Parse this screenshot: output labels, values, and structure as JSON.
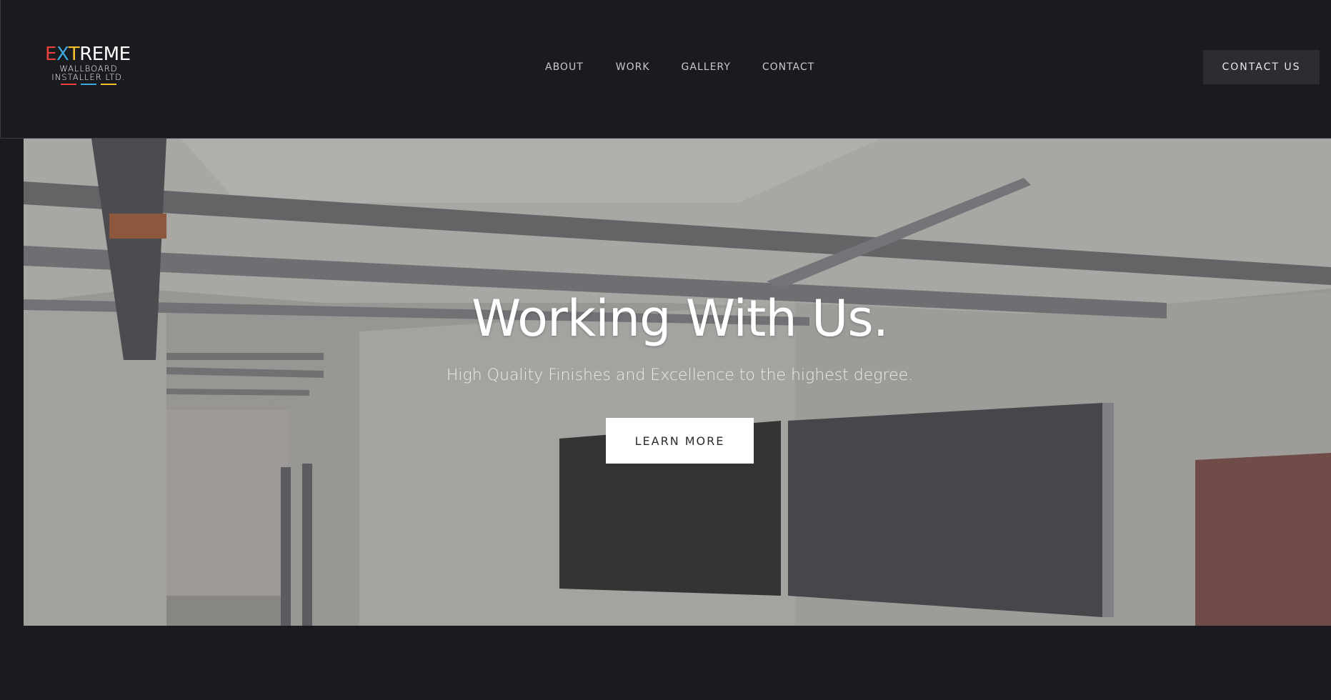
{
  "header": {
    "logo": {
      "word_parts": [
        "E",
        "X",
        "T",
        "REME"
      ],
      "sub_line1": "WALLBOARD",
      "sub_line2": "INSTALLER LTD.",
      "colors": {
        "e": "#e8413c",
        "x": "#3fa9e0",
        "t": "#f3c12d",
        "bar1": "#e8413c",
        "bar2": "#3fa9e0",
        "bar3": "#f3c12d"
      }
    },
    "nav": [
      {
        "label": "ABOUT"
      },
      {
        "label": "WORK"
      },
      {
        "label": "GALLERY"
      },
      {
        "label": "CONTACT"
      }
    ],
    "cta_label": "CONTACT US"
  },
  "hero": {
    "title": "Working With Us.",
    "subtitle": "High Quality Finishes and Excellence to the highest degree.",
    "button_label": "LEARN MORE",
    "background_image": "construction-interior-photo"
  },
  "colors": {
    "page_bg": "#1a1b1f",
    "header_button_bg": "#2b2d33",
    "hero_button_bg": "#ffffff"
  }
}
